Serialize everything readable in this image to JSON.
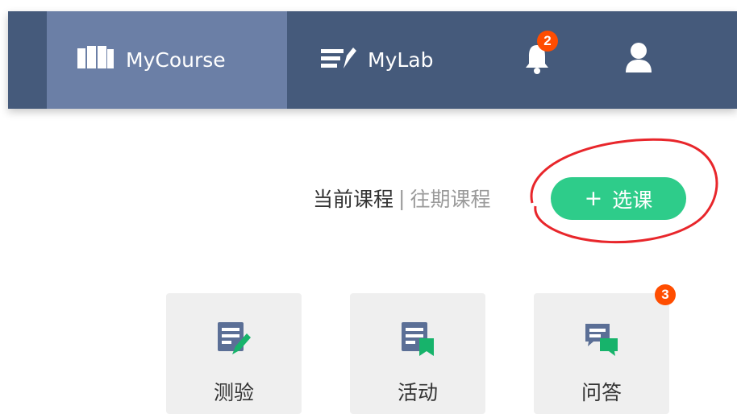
{
  "nav": {
    "items": [
      {
        "label": "MyCourse",
        "icon": "open-book-icon",
        "active": true
      },
      {
        "label": "MyLab",
        "icon": "notes-pencil-icon",
        "active": false
      }
    ],
    "notifications": {
      "icon": "bell-icon",
      "count": "2"
    },
    "user": {
      "icon": "user-icon"
    },
    "colors": {
      "bar": "#455a7b",
      "active": "#6b7fa6"
    }
  },
  "course_tabs": {
    "current": "当前课程",
    "separator": "|",
    "past": "往期课程"
  },
  "select_course_button": {
    "icon": "plus-icon",
    "plus": "+",
    "label": "选课",
    "color": "#2ecc8a"
  },
  "annotation": {
    "shape": "red-ellipse",
    "color": "#e8262b"
  },
  "cards": [
    {
      "label": "测验",
      "icon": "quiz-edit-icon",
      "accent": "#5b6f96"
    },
    {
      "label": "活动",
      "icon": "activity-bookmark-icon",
      "accent": "#17b36b"
    },
    {
      "label": "问答",
      "icon": "qa-chat-icon",
      "accent": "#17b36b",
      "badge": "3"
    }
  ]
}
